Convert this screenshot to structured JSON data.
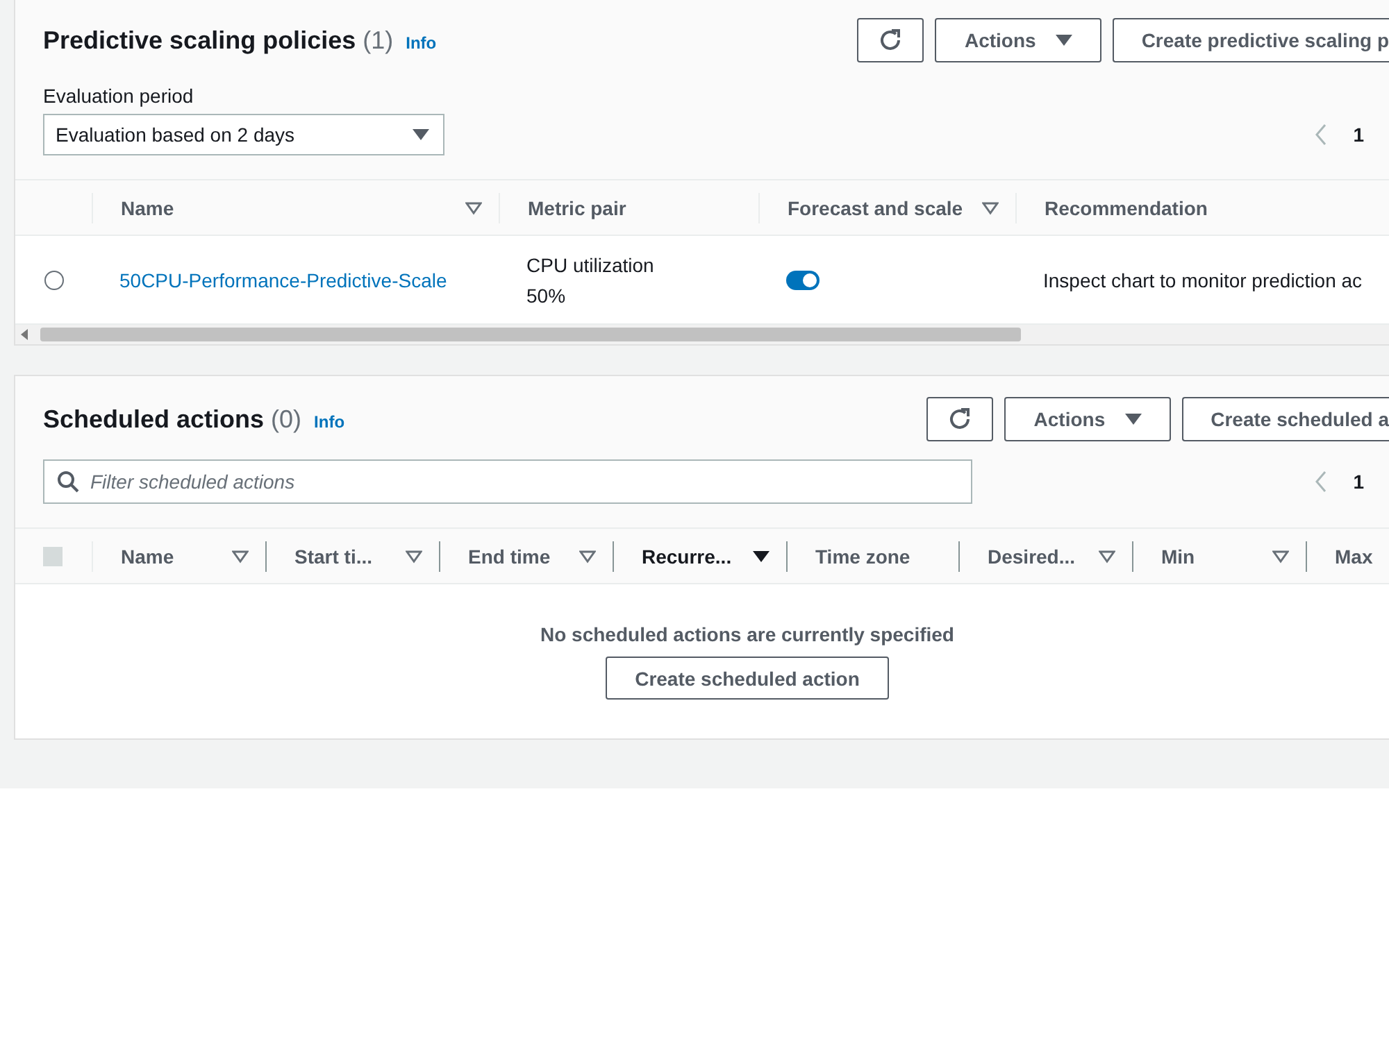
{
  "predictive_policies": {
    "title": "Predictive scaling policies",
    "count": "(1)",
    "info": "Info",
    "buttons": {
      "actions": "Actions",
      "create": "Create predictive scaling p"
    },
    "evaluation_period": {
      "label": "Evaluation period",
      "value": "Evaluation based on 2 days"
    },
    "pagination": {
      "page": "1"
    },
    "columns": [
      {
        "label": "Name",
        "sortable": true,
        "sorted": false
      },
      {
        "label": "Metric pair",
        "sortable": false,
        "sorted": false
      },
      {
        "label": "Forecast and scale",
        "sortable": true,
        "sorted": false
      },
      {
        "label": "Recommendation",
        "sortable": false,
        "sorted": false
      }
    ],
    "rows": [
      {
        "selected": false,
        "name": "50CPU-Performance-Predictive-Scale",
        "metric": "CPU utilization",
        "metric_value": "50%",
        "forecast_on": true,
        "recommendation": "Inspect chart to monitor prediction ac"
      }
    ]
  },
  "scheduled_actions": {
    "title": "Scheduled actions",
    "count": "(0)",
    "info": "Info",
    "buttons": {
      "actions": "Actions",
      "create": "Create scheduled a"
    },
    "filter": {
      "placeholder": "Filter scheduled actions"
    },
    "pagination": {
      "page": "1"
    },
    "select_all": {
      "checked": false,
      "disabled": true
    },
    "columns": [
      {
        "label": "Name",
        "sortable": true,
        "sorted": false
      },
      {
        "label": "Start ti...",
        "sortable": true,
        "sorted": false
      },
      {
        "label": "End time",
        "sortable": true,
        "sorted": false
      },
      {
        "label": "Recurre...",
        "sortable": true,
        "sorted": true
      },
      {
        "label": "Time zone",
        "sortable": false,
        "sorted": false
      },
      {
        "label": "Desired...",
        "sortable": true,
        "sorted": false
      },
      {
        "label": "Min",
        "sortable": true,
        "sorted": false
      },
      {
        "label": "Max",
        "sortable": false,
        "sorted": false
      }
    ],
    "empty_message": "No scheduled actions are currently specified",
    "empty_button": "Create scheduled action"
  }
}
